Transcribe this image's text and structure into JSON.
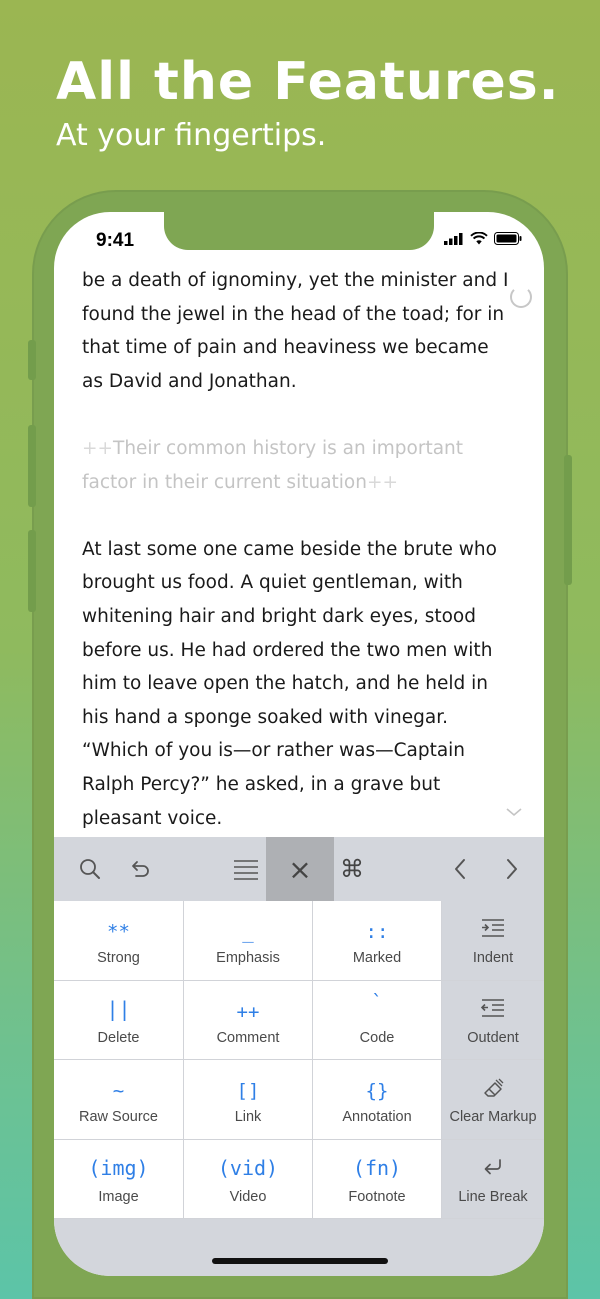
{
  "hero": {
    "title": "All the Features.",
    "subtitle": "At your fingertips."
  },
  "status_bar": {
    "time": "9:41",
    "icons": [
      "signal-icon",
      "wifi-icon",
      "battery-icon"
    ]
  },
  "editor": {
    "paragraph_1": "be a death of ignominy, yet the minister and I found the jewel in the head of the toad; for in that time of pain and heaviness we became as David and Jonathan.",
    "comment_open": "++",
    "comment_text": "Their common history is an important factor in their current situation",
    "comment_close": "++",
    "paragraph_3": "At last some one came beside the brute who brought us food. A quiet gentleman, with whitening hair and bright dark eyes, stood before us. He had ordered the two men with him to leave open the hatch, and he held in his hand a sponge soaked with vinegar. “Which of you is—or rather was—Captain Ralph Percy?” he asked, in a grave but pleasant voice."
  },
  "toolbar": {
    "icons": [
      "search-icon",
      "undo-icon",
      "menu-icon",
      "close-icon",
      "command-icon",
      "chevron-left-icon",
      "chevron-right-icon"
    ],
    "close_glyph": "×",
    "command_glyph": "⌘"
  },
  "markup_keys": [
    {
      "symbol": "**",
      "label": "Strong"
    },
    {
      "symbol": "_",
      "label": "Emphasis"
    },
    {
      "symbol": "::",
      "label": "Marked"
    },
    {
      "icon": "indent-icon",
      "label": "Indent"
    },
    {
      "symbol": "||",
      "label": "Delete"
    },
    {
      "symbol": "++",
      "label": "Comment"
    },
    {
      "symbol": "`",
      "label": "Code"
    },
    {
      "icon": "outdent-icon",
      "label": "Outdent"
    },
    {
      "symbol": "~",
      "label": "Raw Source"
    },
    {
      "symbol": "[]",
      "label": "Link"
    },
    {
      "symbol": "{}",
      "label": "Annotation"
    },
    {
      "icon": "eraser-icon",
      "label": "Clear Markup"
    },
    {
      "symbol": "(img)",
      "label": "Image"
    },
    {
      "symbol": "(vid)",
      "label": "Video"
    },
    {
      "symbol": "(fn)",
      "label": "Footnote"
    },
    {
      "icon": "return-icon",
      "label": "Line Break"
    }
  ],
  "colors": {
    "background_top": "#9bb652",
    "background_bottom": "#5cc4a8",
    "phone_frame": "#7fa653",
    "accent_blue": "#2f7fe6",
    "keyboard_gray": "#d3d6dc"
  }
}
